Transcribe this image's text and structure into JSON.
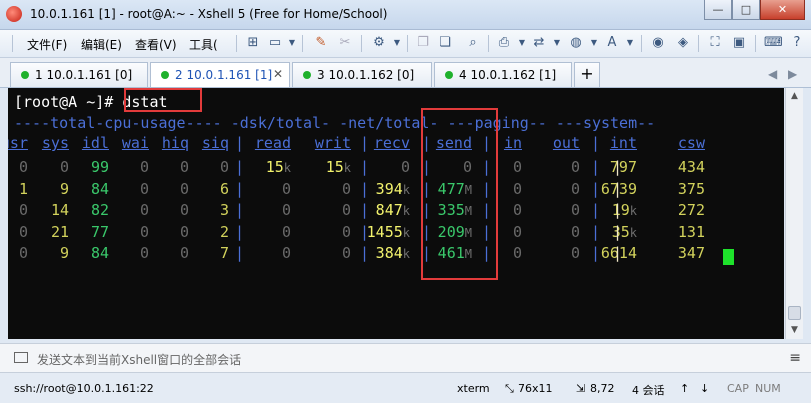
{
  "window": {
    "title": "10.0.1.161 [1] - root@A:~ - Xshell 5 (Free for Home/School)",
    "buttons": {
      "minimize": "—",
      "maximize": "□",
      "close": "✕"
    }
  },
  "menu": [
    "文件(F)",
    "编辑(E)",
    "查看(V)",
    "工具(",
    "..."
  ],
  "tabs": [
    {
      "label": "1 10.0.1.161 [0]",
      "active": false
    },
    {
      "label": "2 10.0.1.161 [1]",
      "active": true
    },
    {
      "label": "3 10.0.1.162 [0]",
      "active": false
    },
    {
      "label": "4 10.0.1.162 [1]",
      "active": false
    }
  ],
  "tab_add": "+",
  "tab_nav": {
    "prev": "◀",
    "next": "▶"
  },
  "terminal": {
    "prompt": "[root@A ~]#",
    "command": "dstat",
    "group_header": "----total-cpu-usage---- -dsk/total- -net/total- ---paging-- ---system--",
    "columns": [
      "usr",
      "sys",
      "idl",
      "wai",
      "hiq",
      "siq",
      "read",
      "writ",
      "recv",
      "send",
      "in",
      "out",
      "int",
      "csw"
    ],
    "rows": [
      [
        "0",
        "0",
        "99",
        "0",
        "0",
        "0",
        "15k",
        "15k",
        "0",
        "0",
        "0",
        "0",
        "797",
        "434"
      ],
      [
        "1",
        "9",
        "84",
        "0",
        "0",
        "6",
        "0",
        "0",
        "394k",
        "477M",
        "0",
        "0",
        "6739",
        "375"
      ],
      [
        "0",
        "14",
        "82",
        "0",
        "0",
        "3",
        "0",
        "0",
        "847k",
        "335M",
        "0",
        "0",
        "19k",
        "272"
      ],
      [
        "0",
        "21",
        "77",
        "0",
        "0",
        "2",
        "0",
        "0",
        "1455k",
        "209M",
        "0",
        "0",
        "35k",
        "131"
      ],
      [
        "0",
        "9",
        "84",
        "0",
        "0",
        "7",
        "0",
        "0",
        "384k",
        "461M",
        "0",
        "0",
        "6614",
        "347"
      ]
    ]
  },
  "sendbar": {
    "text": "发送文本到当前Xshell窗口的全部会话",
    "menu_icon": "≡"
  },
  "status": {
    "session": "ssh://root@10.0.1.161:22",
    "term": "xterm",
    "size": "76x11",
    "pos": "8,72",
    "sessions": "4 会话",
    "cap": "CAP",
    "num": "NUM"
  }
}
